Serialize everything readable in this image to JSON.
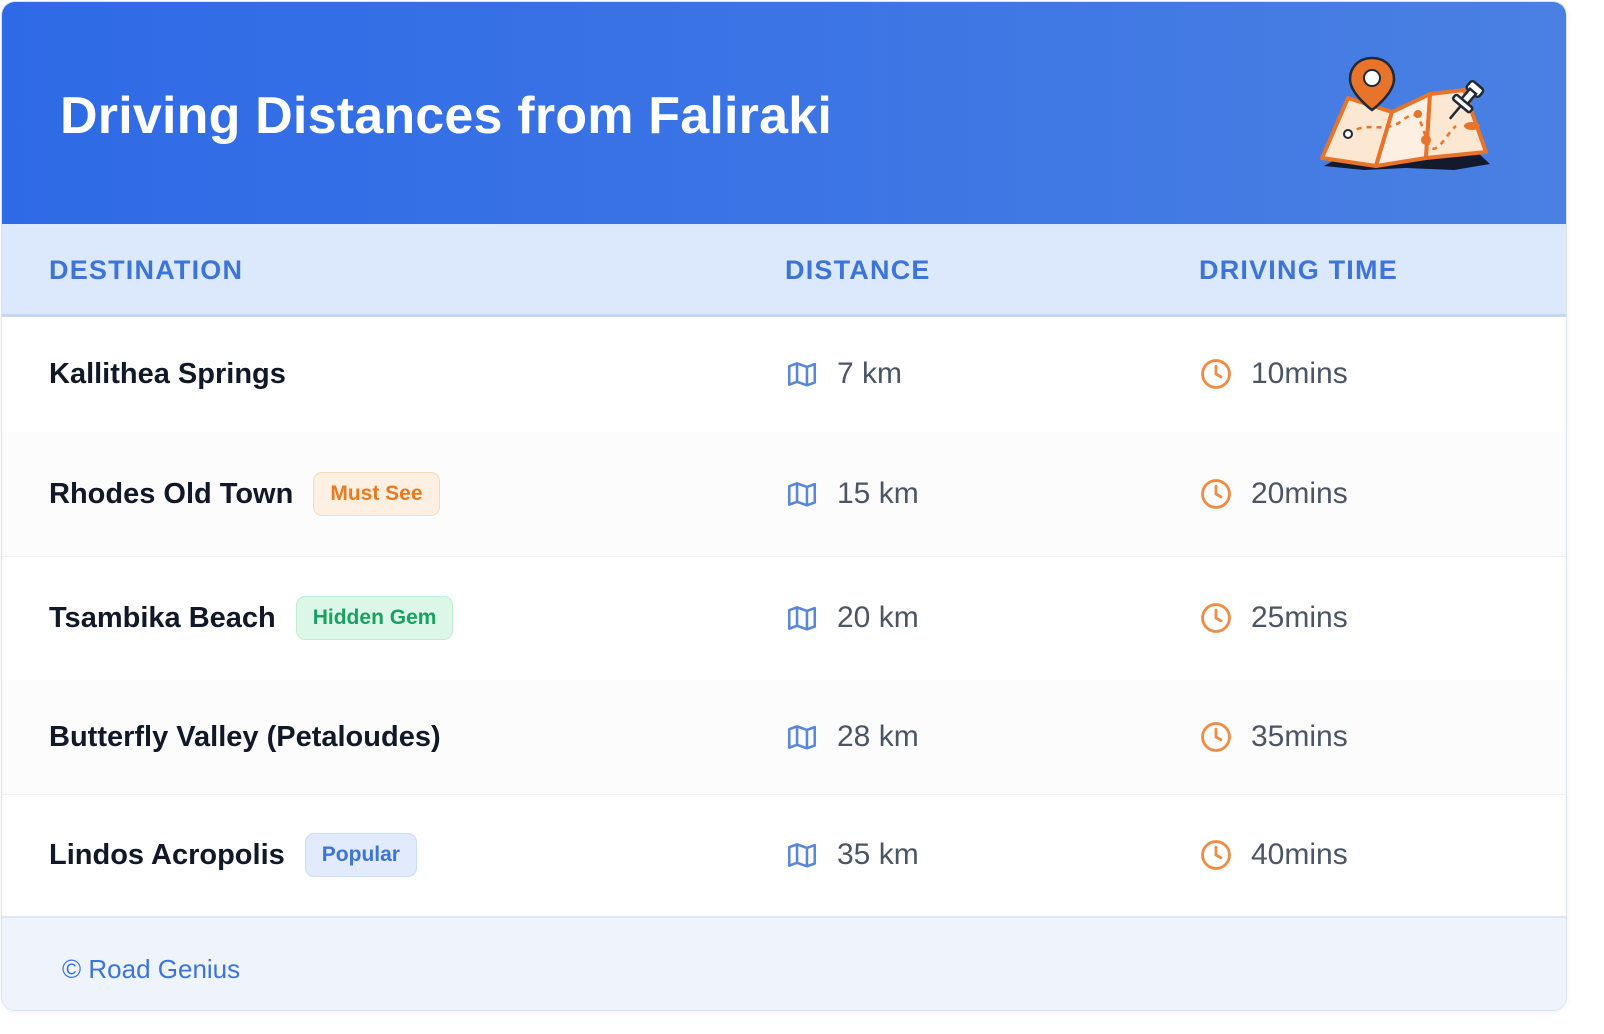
{
  "header": {
    "title": "Driving Distances from Faliraki",
    "illustration_icon": "map-with-pin-icon"
  },
  "table": {
    "columns": [
      "DESTINATION",
      "DISTANCE",
      "DRIVING TIME"
    ],
    "distance_icon": "map-icon",
    "time_icon": "clock-icon",
    "rows": [
      {
        "destination": "Kallithea Springs",
        "badge": "",
        "distance": "7 km",
        "time": "10mins"
      },
      {
        "destination": "Rhodes Old Town",
        "badge": "Must See",
        "distance": "15 km",
        "time": "20mins"
      },
      {
        "destination": "Tsambika Beach",
        "badge": "Hidden Gem",
        "distance": "20 km",
        "time": "25mins"
      },
      {
        "destination": "Butterfly Valley (Petaloudes)",
        "badge": "",
        "distance": "28 km",
        "time": "35mins"
      },
      {
        "destination": "Lindos Acropolis",
        "badge": "Popular",
        "distance": "35 km",
        "time": "40mins"
      }
    ]
  },
  "badge_styles": {
    "Must See": {
      "bg": "#fdf0e3",
      "border": "#f8d9b8",
      "color": "#ea7a1f"
    },
    "Hidden Gem": {
      "bg": "#dcf7e8",
      "border": "#bfeed5",
      "color": "#1aa060"
    },
    "Popular": {
      "bg": "#e1ebfc",
      "border": "#cbdcf7",
      "color": "#3d74d9"
    }
  },
  "colors": {
    "header_blue": "#2f6ae6",
    "accent_blue": "#3d74d9",
    "clock_orange": "#ef8c46"
  },
  "footer": {
    "copyright": "© Road Genius"
  }
}
